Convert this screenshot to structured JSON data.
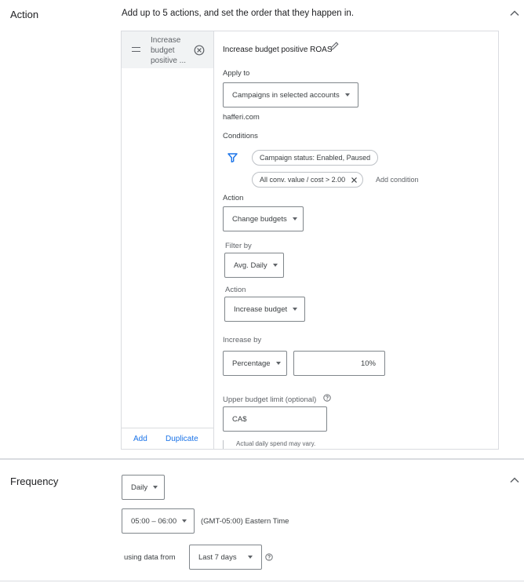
{
  "action_section": {
    "title": "Action",
    "subtitle": "Add up to 5 actions, and set the order that they happen in.",
    "list": {
      "items": [
        {
          "label": "Increase budget positive ..."
        }
      ],
      "add_label": "Add",
      "duplicate_label": "Duplicate"
    },
    "editor": {
      "title": "Increase budget positive ROAS",
      "apply_to_label": "Apply to",
      "apply_to_value": "Campaigns in selected accounts",
      "account": "hafferi.com",
      "conditions_label": "Conditions",
      "conditions": [
        "Campaign status: Enabled, Paused",
        "All conv. value / cost > 2.00"
      ],
      "add_condition": "Add condition",
      "action_label": "Action",
      "action_value": "Change budgets",
      "filter_by_label": "Filter by",
      "filter_by_value": "Avg. Daily",
      "sub_action_label": "Action",
      "sub_action_value": "Increase budget",
      "increase_by_label": "Increase by",
      "increase_by_type": "Percentage",
      "increase_by_value": "10%",
      "upper_limit_label": "Upper budget limit (optional)",
      "upper_limit_prefix": "CA$",
      "note": "Actual daily spend may vary."
    }
  },
  "frequency_section": {
    "title": "Frequency",
    "frequency_value": "Daily",
    "time_value": "05:00 – 06:00",
    "timezone": "(GMT-05:00) Eastern Time",
    "using_data_label": "using data from",
    "range_value": "Last 7 days"
  },
  "colors": {
    "accent": "#1a73e8",
    "border": "#dadce0",
    "selected_bg": "#f1f3f4"
  }
}
